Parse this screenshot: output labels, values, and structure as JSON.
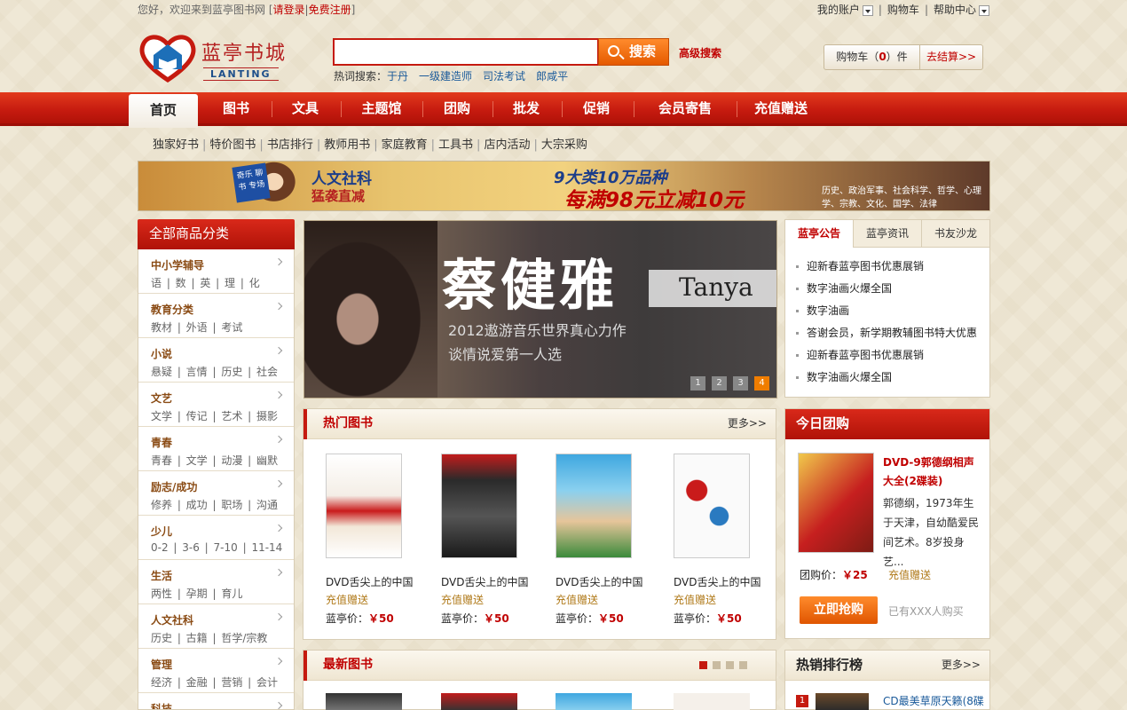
{
  "topbar": {
    "welcome": "您好，欢迎来到蓝亭图书网",
    "login": "请登录",
    "register": "免费注册",
    "my_account": "我的账户",
    "cart": "购物车",
    "help": "帮助中心"
  },
  "logo": {
    "cn": "蓝亭书城",
    "en": "LANTING"
  },
  "search": {
    "button": "搜索",
    "advanced": "高级搜索",
    "hot_label": "热词搜索：",
    "hot_words": [
      "于丹",
      "一级建造师",
      "司法考试",
      "郎咸平"
    ]
  },
  "cart": {
    "label_pre": "购物车（",
    "count": "0",
    "label_post": "）件",
    "checkout": "去结算>>"
  },
  "nav": [
    "首页",
    "图书",
    "文具",
    "主题馆",
    "团购",
    "批发",
    "促销",
    "会员寄售",
    "充值赠送"
  ],
  "subnav": [
    "独家好书",
    "特价图书",
    "书店排行",
    "教师用书",
    "家庭教育",
    "工具书",
    "店内活动",
    "大宗采购"
  ],
  "banner": {
    "tag": "奇乐 聊书 专场",
    "t1": "人文社科",
    "t2": "猛袭直减",
    "t3": "9大类10万品种",
    "t4": "每满98元立减10元",
    "t5": "历史、政治军事、社会科学、哲学、心理学、宗教、文化、国学、法律"
  },
  "categories_title": "全部商品分类",
  "categories": [
    {
      "title": "中小学辅导",
      "subs": "语 | 数 | 英 | 理 | 化"
    },
    {
      "title": "教育分类",
      "subs": "教材 | 外语 | 考试"
    },
    {
      "title": "小说",
      "subs": "悬疑 | 言情 | 历史 | 社会"
    },
    {
      "title": "文艺",
      "subs": "文学 | 传记 | 艺术 | 摄影"
    },
    {
      "title": "青春",
      "subs": "青春 | 文学 | 动漫 | 幽默"
    },
    {
      "title": "励志/成功",
      "subs": "修养 | 成功 | 职场 | 沟通"
    },
    {
      "title": "少儿",
      "subs": "0-2 | 3-6 | 7-10 | 11-14"
    },
    {
      "title": "生活",
      "subs": "两性 | 孕期 | 育儿"
    },
    {
      "title": "人文社科",
      "subs": "历史 | 古籍 | 哲学/宗教"
    },
    {
      "title": "管理",
      "subs": "经济 | 金融 | 营销 | 会计"
    },
    {
      "title": "科技",
      "subs": ""
    }
  ],
  "slide": {
    "name": "蔡健雅",
    "en": "Tanya",
    "line1": "2012遨游音乐世界真心力作",
    "line2": "谈情说爱第一人选",
    "dots": [
      "1",
      "2",
      "3",
      "4"
    ]
  },
  "hot_books": {
    "title": "热门图书",
    "more": "更多>>",
    "items": [
      {
        "name": "DVD舌尖上的中国",
        "gift": "充值赠送",
        "price_label": "蓝亭价：",
        "price": "￥50"
      },
      {
        "name": "DVD舌尖上的中国",
        "gift": "充值赠送",
        "price_label": "蓝亭价：",
        "price": "￥50"
      },
      {
        "name": "DVD舌尖上的中国",
        "gift": "充值赠送",
        "price_label": "蓝亭价：",
        "price": "￥50"
      },
      {
        "name": "DVD舌尖上的中国",
        "gift": "充值赠送",
        "price_label": "蓝亭价：",
        "price": "￥50"
      }
    ]
  },
  "new_books": {
    "title": "最新图书"
  },
  "tabs": [
    "蓝亭公告",
    "蓝亭资讯",
    "书友沙龙"
  ],
  "notices": [
    "迎新春蓝亭图书优惠展销",
    "数字油画火爆全国",
    "数字油画",
    "答谢会员，新学期教辅图书特大优惠",
    "迎新春蓝亭图书优惠展销",
    "数字油画火爆全国"
  ],
  "tuan": {
    "head": "今日团购",
    "title": "DVD-9郭德纲相声大全(2碟装)",
    "desc": "郭德纲，1973年生于天津，自幼酷爱民间艺术。8岁投身艺...",
    "price_label": "团购价：",
    "price": "￥25",
    "gift": "充值赠送",
    "buy": "立即抢购",
    "count": "已有XXX人购买"
  },
  "rank": {
    "title": "热销排行榜",
    "more": "更多>>",
    "first_num": "1",
    "first_title": "CD最美草原天籁(8碟"
  }
}
